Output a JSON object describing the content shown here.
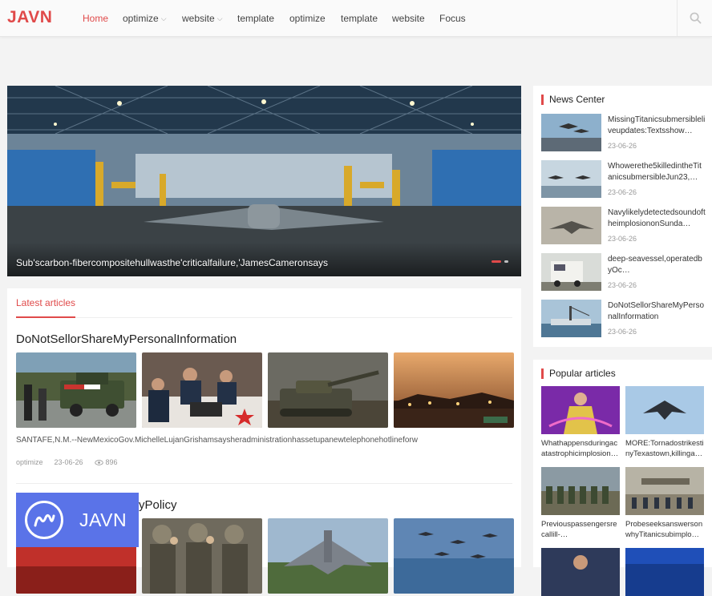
{
  "header": {
    "logo": "JAVN",
    "nav": [
      {
        "label": "Home",
        "active": true,
        "dropdown": false
      },
      {
        "label": "optimize",
        "active": false,
        "dropdown": true
      },
      {
        "label": "website",
        "active": false,
        "dropdown": true
      },
      {
        "label": "template",
        "active": false,
        "dropdown": false
      },
      {
        "label": "optimize",
        "active": false,
        "dropdown": false
      },
      {
        "label": "template",
        "active": false,
        "dropdown": false
      },
      {
        "label": "website",
        "active": false,
        "dropdown": false
      },
      {
        "label": "Focus",
        "active": false,
        "dropdown": false
      }
    ],
    "search_icon": "search-icon"
  },
  "hero": {
    "caption": "Sub'scarbon-fibercompositehullwasthe'criticalfailure,'JamesCameronsays",
    "active_slide": 1,
    "slide_count": 2
  },
  "latest": {
    "tab_label": "Latest articles",
    "articles": [
      {
        "title": "DoNotSellorShareMyPersonalInformation",
        "excerpt": "SANTAFE,N.M.--NewMexicoGov.MichelleLujanGrishamsaysheradministrationhassetupanewtelephonehotlineforw",
        "category": "optimize",
        "date": "23-06-26",
        "views": "896"
      },
      {
        "title": "yPolicy"
      }
    ]
  },
  "brand_badge": {
    "text": "JAVN"
  },
  "news_center": {
    "title": "News Center",
    "items": [
      {
        "title": "MissingTitanicsubmersibleliveupdates:Textsshow…",
        "date": "23-06-26"
      },
      {
        "title": "Whowerethe5killedintheTitanicsubmersibleJun23,…",
        "date": "23-06-26"
      },
      {
        "title": "NavylikelydetectedsoundoftheimplosiononSunda…",
        "date": "23-06-26"
      },
      {
        "title": "deep-seavessel,operatedbyOc…",
        "date": "23-06-26"
      },
      {
        "title": "DoNotSellorShareMyPersonalInformation",
        "date": "23-06-26"
      }
    ]
  },
  "popular": {
    "title": "Popular articles",
    "items": [
      {
        "title": "Whathappensduringacatastrophicimplosion…"
      },
      {
        "title": "MORE:Tornadostrikesti nyTexastown,killinga…"
      },
      {
        "title": "Previouspassengersrecallill-…"
      },
      {
        "title": "ProbeseeksanswersonwhyTitanicsubimplo…"
      }
    ]
  },
  "colors": {
    "accent": "#e04a4a",
    "brand_badge": "#5a73e8"
  }
}
